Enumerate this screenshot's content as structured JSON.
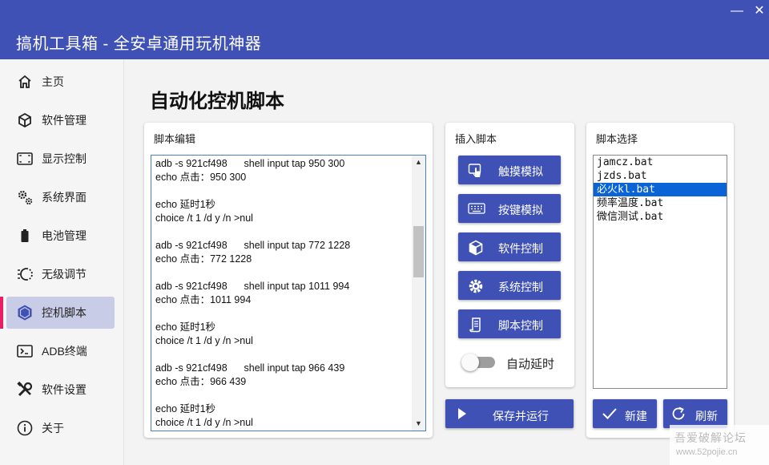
{
  "window": {
    "title": "搞机工具箱 - 全安卓通用玩机神器",
    "minimize": "—",
    "close": "✕"
  },
  "sidebar": {
    "items": [
      {
        "label": "主页",
        "icon": "home-icon"
      },
      {
        "label": "软件管理",
        "icon": "package-icon"
      },
      {
        "label": "显示控制",
        "icon": "display-icon"
      },
      {
        "label": "系统界面",
        "icon": "gears-icon"
      },
      {
        "label": "电池管理",
        "icon": "battery-icon"
      },
      {
        "label": "无级调节",
        "icon": "slider-icon"
      },
      {
        "label": "控机脚本",
        "icon": "hexagon-icon",
        "active": true
      },
      {
        "label": "ADB终端",
        "icon": "terminal-icon"
      },
      {
        "label": "软件设置",
        "icon": "tools-icon"
      },
      {
        "label": "关于",
        "icon": "info-icon"
      }
    ],
    "active_color": "#e91e63"
  },
  "main": {
    "title": "自动化控机脚本",
    "editor": {
      "title": "脚本编辑",
      "lines": [
        "adb -s 921cf498      shell input tap 950 300",
        "echo 点击：950 300",
        "",
        "echo 延时1秒",
        "choice /t 1 /d y /n >nul",
        "",
        "adb -s 921cf498      shell input tap 772 1228",
        "echo 点击：772 1228",
        "",
        "adb -s 921cf498      shell input tap 1011 994",
        "echo 点击：1011 994",
        "",
        "echo 延时1秒",
        "choice /t 1 /d y /n >nul",
        "",
        "adb -s 921cf498      shell input tap 966 439",
        "echo 点击：966 439",
        "",
        "echo 延时1秒",
        "choice /t 1 /d y /n >nul"
      ],
      "scroll_up": "▲",
      "scroll_down": "▼"
    },
    "insert": {
      "title": "插入脚本",
      "buttons": [
        {
          "label": "触摸模拟",
          "icon": "touch-icon"
        },
        {
          "label": "按键模拟",
          "icon": "keyboard-icon"
        },
        {
          "label": "软件控制",
          "icon": "cube-icon"
        },
        {
          "label": "系统控制",
          "icon": "gear-icon"
        },
        {
          "label": "脚本控制",
          "icon": "scroll-icon"
        }
      ],
      "toggle_label": "自动延时",
      "toggle_on": false
    },
    "save_run": "保存并运行",
    "script_select": {
      "title": "脚本选择",
      "files": [
        "jamcz.bat",
        "jzds.bat",
        "必火kl.bat",
        "频率温度.bat",
        "微信测试.bat"
      ],
      "selected_index": 2,
      "new_label": "新建",
      "refresh_label": "刷新"
    }
  },
  "colors": {
    "primary": "#3f51b5",
    "selection": "#0a64d6",
    "active_nav_bg": "#c9cce6"
  },
  "watermark": {
    "line1": "吾爱破解论坛",
    "line2": "www.52pojie.cn"
  }
}
